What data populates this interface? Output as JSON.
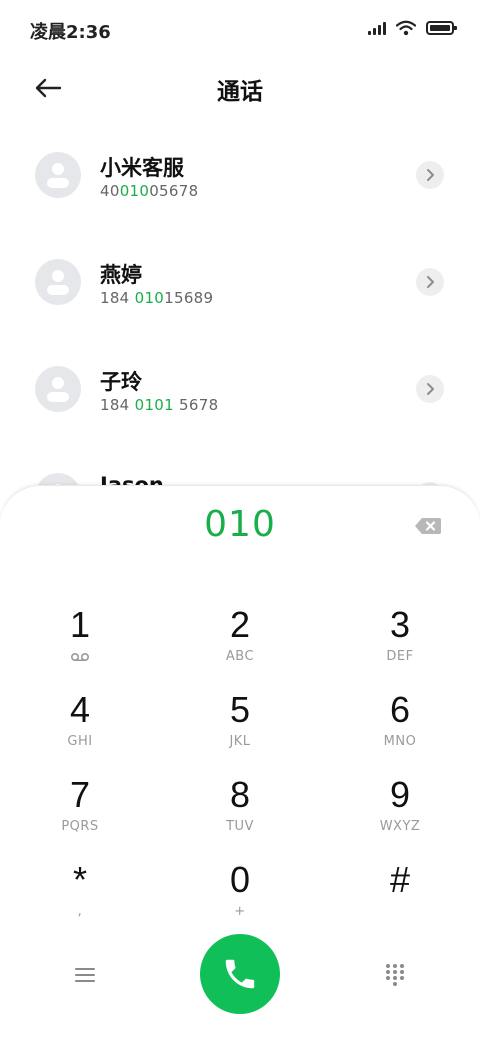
{
  "status_bar": {
    "time": "凌晨2:36",
    "icons": [
      "signal-icon",
      "wifi-icon",
      "battery-icon"
    ]
  },
  "header": {
    "back_icon": "arrow-left-icon",
    "title": "通话"
  },
  "contacts": [
    {
      "name": "小米客服",
      "number_pre": "40",
      "number_match": "010",
      "number_post": "05678"
    },
    {
      "name": "燕婷",
      "number_pre": "184 ",
      "number_match": "010",
      "number_post": "15689"
    },
    {
      "name": "子玲",
      "number_pre": "184 ",
      "number_match": "0101",
      "number_post": " 5678"
    },
    {
      "name": "Jason",
      "number_pre": "",
      "number_match": "",
      "number_post": ""
    }
  ],
  "dialer": {
    "typed_number": "010",
    "delete_icon": "backspace-icon",
    "keys": [
      {
        "digit": "1",
        "letters": ""
      },
      {
        "digit": "2",
        "letters": "ABC"
      },
      {
        "digit": "3",
        "letters": "DEF"
      },
      {
        "digit": "4",
        "letters": "GHI"
      },
      {
        "digit": "5",
        "letters": "JKL"
      },
      {
        "digit": "6",
        "letters": "MNO"
      },
      {
        "digit": "7",
        "letters": "PQRS"
      },
      {
        "digit": "8",
        "letters": "TUV"
      },
      {
        "digit": "9",
        "letters": "WXYZ"
      },
      {
        "digit": "*",
        "letters": ","
      },
      {
        "digit": "0",
        "letters": "+"
      },
      {
        "digit": "#",
        "letters": ""
      }
    ],
    "bottom": {
      "menu_icon": "menu-icon",
      "call_icon": "phone-icon",
      "grid_icon": "dialpad-grid-icon"
    }
  },
  "colors": {
    "accent": "#1aae4a",
    "call_button": "#10bf58",
    "avatar_bg": "#e6e7ea"
  }
}
